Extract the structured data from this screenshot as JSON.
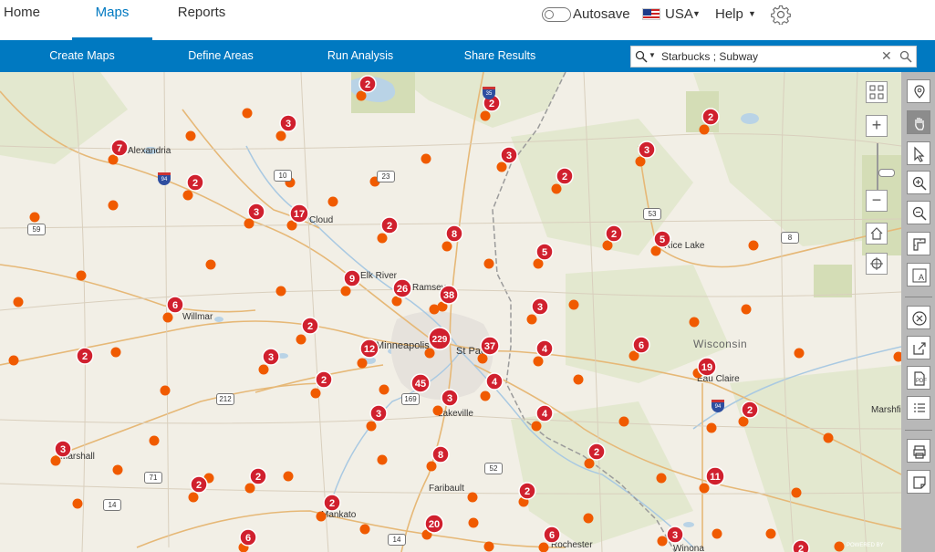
{
  "topbar": {
    "tabs": [
      {
        "label": "Home",
        "active": false
      },
      {
        "label": "Maps",
        "active": true
      },
      {
        "label": "Reports",
        "active": false
      }
    ],
    "autosave_label": "Autosave",
    "autosave_on": false,
    "country_label": "USA",
    "help_label": "Help",
    "settings_icon": "gear-icon"
  },
  "navbar": {
    "items": [
      "Create Maps",
      "Define Areas",
      "Run Analysis",
      "Share Results"
    ],
    "search_value": "Starbucks ; Subway"
  },
  "map": {
    "region_label": "Wisconsin",
    "cities": [
      "Alexandria",
      "Cloud",
      "Elk River",
      "Ramsey",
      "Willmar",
      "Minneapolis",
      "St Paul",
      "Lakeville",
      "Marshall",
      "Faribault",
      "Mankato",
      "Rochester",
      "Winona",
      "Eau Claire",
      "Marshfi",
      "Rice Lake"
    ],
    "road_shields": [
      "94",
      "10",
      "23",
      "59",
      "53",
      "8",
      "212",
      "169",
      "52",
      "71",
      "14",
      "14",
      "94",
      "35"
    ],
    "clusters": [
      {
        "label": "2"
      },
      {
        "label": "2"
      },
      {
        "label": "3"
      },
      {
        "label": "7"
      },
      {
        "label": "2"
      },
      {
        "label": "3"
      },
      {
        "label": "17"
      },
      {
        "label": "2"
      },
      {
        "label": "8"
      },
      {
        "label": "2"
      },
      {
        "label": "3"
      },
      {
        "label": "2"
      },
      {
        "label": "2"
      },
      {
        "label": "5"
      },
      {
        "label": "5"
      },
      {
        "label": "9"
      },
      {
        "label": "26"
      },
      {
        "label": "38"
      },
      {
        "label": "6"
      },
      {
        "label": "2"
      },
      {
        "label": "3"
      },
      {
        "label": "229"
      },
      {
        "label": "37"
      },
      {
        "label": "4"
      },
      {
        "label": "12"
      },
      {
        "label": "2"
      },
      {
        "label": "3"
      },
      {
        "label": "2"
      },
      {
        "label": "6"
      },
      {
        "label": "19"
      },
      {
        "label": "45"
      },
      {
        "label": "3"
      },
      {
        "label": "4"
      },
      {
        "label": "2"
      },
      {
        "label": "3"
      },
      {
        "label": "4"
      },
      {
        "label": "3"
      },
      {
        "label": "8"
      },
      {
        "label": "3"
      },
      {
        "label": "2"
      },
      {
        "label": "2"
      },
      {
        "label": "2"
      },
      {
        "label": "11"
      },
      {
        "label": "2"
      },
      {
        "label": "6"
      },
      {
        "label": "20"
      },
      {
        "label": "6"
      },
      {
        "label": "3"
      },
      {
        "label": "2"
      },
      {
        "label": "2"
      }
    ],
    "attribution": "POWERED BY"
  },
  "toolbar": {
    "tools": [
      "location-pin-icon",
      "pan-hand-icon",
      "select-arrow-icon",
      "zoom-in-icon",
      "zoom-out-icon",
      "measure-icon",
      "label-icon",
      "clear-icon",
      "export-icon",
      "pdf-icon",
      "legend-list-icon",
      "print-icon",
      "note-icon"
    ]
  },
  "colors": {
    "brand_blue": "#0079c1",
    "cluster_red": "#d0202e",
    "point_orange": "#f05a00"
  }
}
